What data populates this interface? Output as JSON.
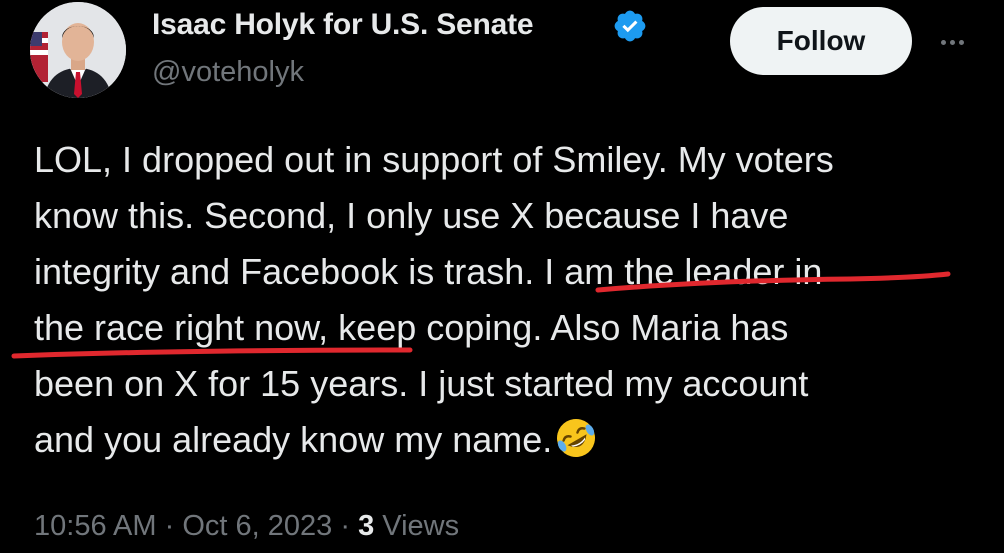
{
  "author": {
    "display_name": "Isaac Holyk for U.S. Senate",
    "handle": "@voteholyk",
    "verified_icon": "verified-badge-icon",
    "avatar_icon": "profile-photo"
  },
  "actions": {
    "follow_label": "Follow",
    "more_icon": "more-options-icon"
  },
  "tweet": {
    "lines": [
      "LOL, I dropped out in support of Smiley. My voters",
      "know this. Second, I only use X because I have",
      "integrity and Facebook is trash. I am the leader in",
      "the race right now, keep coping. Also Maria has",
      "been on X for 15 years. I just started my account",
      "and you already know my name."
    ],
    "emoji": "rolling-on-floor-laughing-emoji"
  },
  "annotation": {
    "color": "#e0282e"
  },
  "meta": {
    "time": "10:56 AM",
    "separator": "·",
    "date": "Oct 6, 2023",
    "views_count": "3",
    "views_label": "Views"
  },
  "colors": {
    "background": "#000000",
    "text": "#e7e9ea",
    "secondary": "#71767b",
    "verified": "#1d9bf0",
    "follow_bg": "#eff3f4"
  }
}
